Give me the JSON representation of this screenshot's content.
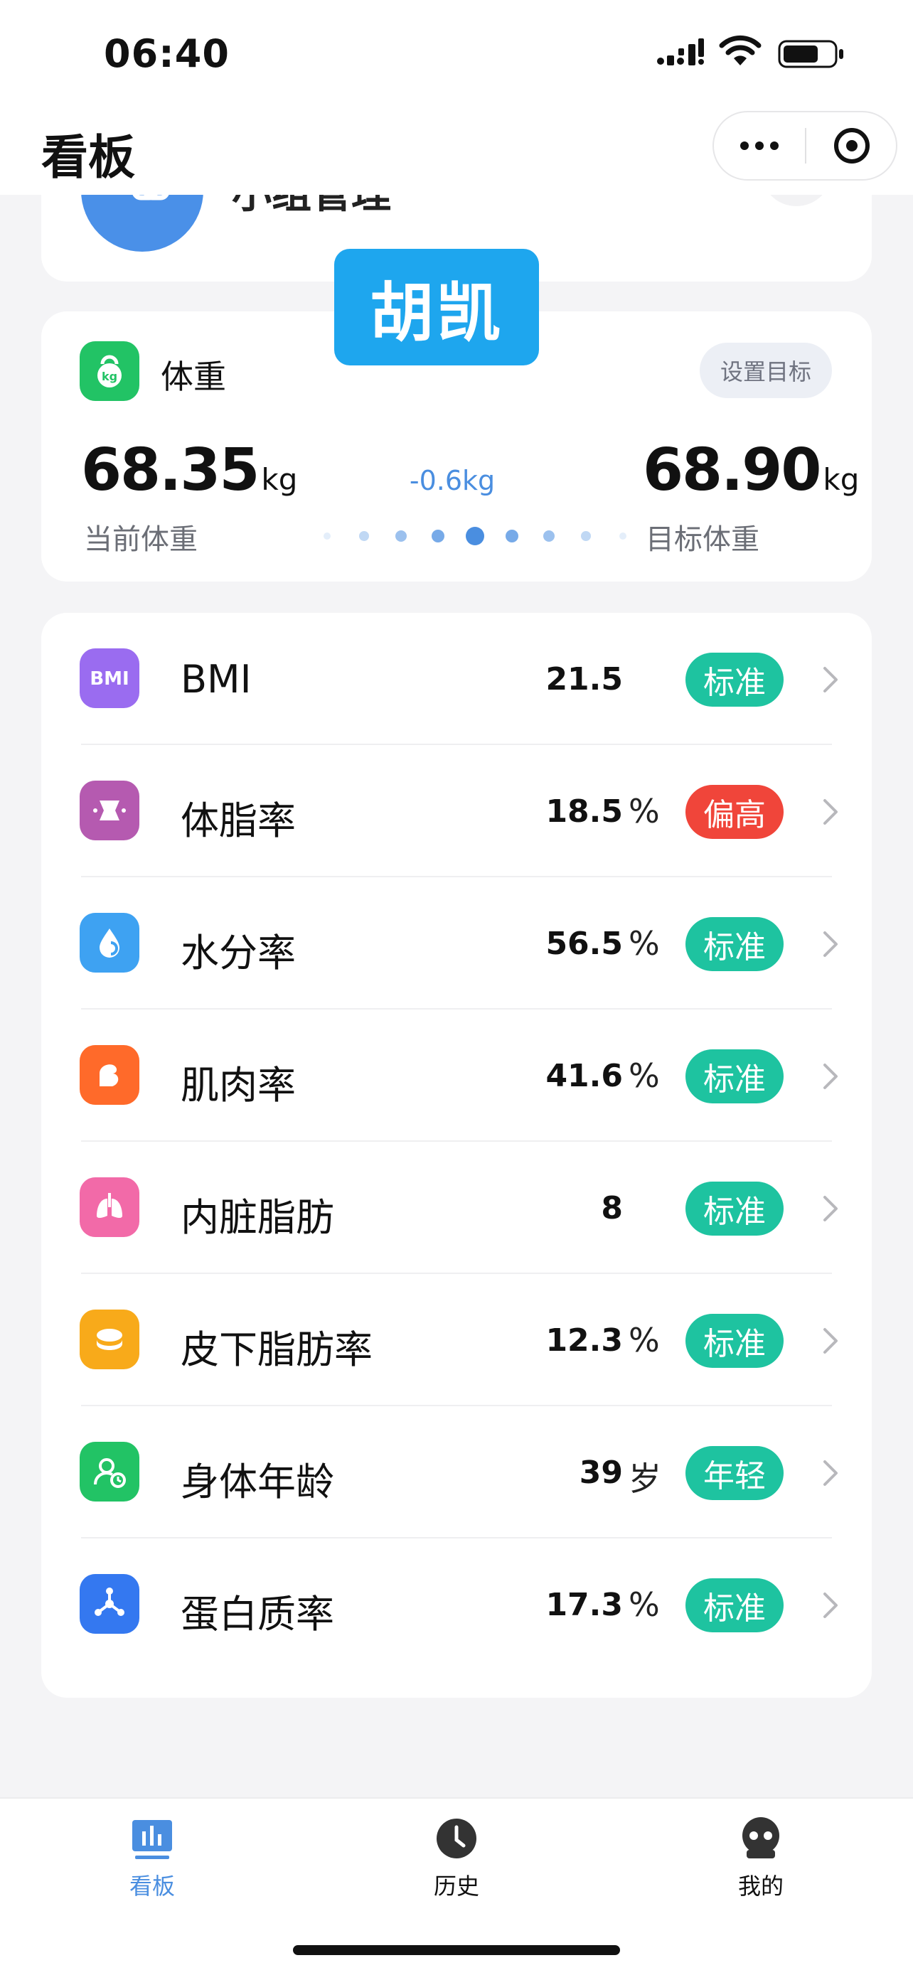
{
  "status_bar": {
    "time": "06:40"
  },
  "nav": {
    "title": "看板"
  },
  "group": {
    "title": "小组管理"
  },
  "name_tag": "胡凯",
  "weight": {
    "title": "体重",
    "goal_button": "设置目标",
    "current_value": "68.35",
    "current_unit": "kg",
    "current_label": "当前体重",
    "target_value": "68.90",
    "target_unit": "kg",
    "target_label": "目标体重",
    "diff": "-0.6kg",
    "slider_active_index": 4
  },
  "metrics": [
    {
      "name": "BMI",
      "value": "21.5",
      "unit": "",
      "status": "标准",
      "status_color": "#1ec3a0",
      "icon": "bmi-icon",
      "icon_color": "#9a6cf0"
    },
    {
      "name": "体脂率",
      "value": "18.5",
      "unit": "%",
      "status": "偏高",
      "status_color": "#f0453a",
      "icon": "body-fat-icon",
      "icon_color": "#b55ab0"
    },
    {
      "name": "水分率",
      "value": "56.5",
      "unit": "%",
      "status": "标准",
      "status_color": "#1ec3a0",
      "icon": "water-drop-icon",
      "icon_color": "#3ea2f2"
    },
    {
      "name": "肌肉率",
      "value": "41.6",
      "unit": "%",
      "status": "标准",
      "status_color": "#1ec3a0",
      "icon": "muscle-arm-icon",
      "icon_color": "#ff6a2a"
    },
    {
      "name": "内脏脂肪",
      "value": "8",
      "unit": "",
      "status": "标准",
      "status_color": "#1ec3a0",
      "icon": "lungs-icon",
      "icon_color": "#f26aa8"
    },
    {
      "name": "皮下脂肪率",
      "value": "12.3",
      "unit": "%",
      "status": "标准",
      "status_color": "#1ec3a0",
      "icon": "subcutaneous-fat-icon",
      "icon_color": "#f8aa1a"
    },
    {
      "name": "身体年龄",
      "value": "39",
      "unit": "岁",
      "status": "年轻",
      "status_color": "#1ec3a0",
      "icon": "body-age-icon",
      "icon_color": "#22c365"
    },
    {
      "name": "蛋白质率",
      "value": "17.3",
      "unit": "%",
      "status": "标准",
      "status_color": "#1ec3a0",
      "icon": "protein-molecule-icon",
      "icon_color": "#3478f0"
    }
  ],
  "tabs": [
    {
      "label": "看板",
      "icon": "dashboard-chart-icon",
      "active": true
    },
    {
      "label": "历史",
      "icon": "clock-icon",
      "active": false
    },
    {
      "label": "我的",
      "icon": "profile-face-icon",
      "active": false
    }
  ]
}
